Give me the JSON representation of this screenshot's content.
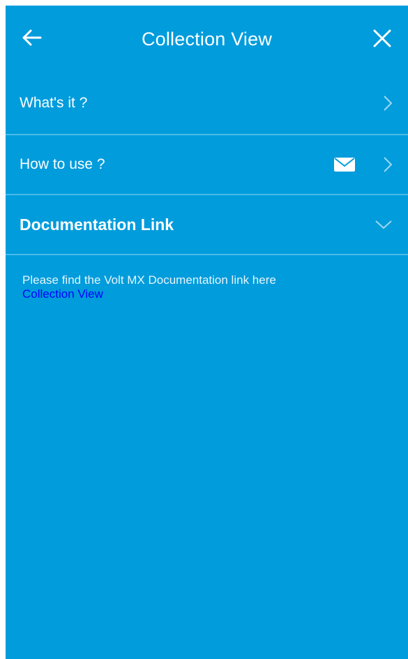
{
  "header": {
    "title": "Collection View"
  },
  "menu": {
    "items": [
      {
        "label": "What's it ?"
      },
      {
        "label": "How to use ?"
      },
      {
        "label": "Documentation Link"
      }
    ]
  },
  "content": {
    "text": "Please find the Volt MX Documentation link here",
    "link_label": "Collection View"
  },
  "colors": {
    "background": "#009cdc",
    "divider": "#4cbbe8",
    "link": "#0000ff",
    "text": "#ffffff"
  },
  "icons": {
    "back": "arrow-left-icon",
    "close": "close-icon",
    "chevron_right": "chevron-right-icon",
    "chevron_down": "chevron-down-icon",
    "mail": "mail-icon"
  }
}
